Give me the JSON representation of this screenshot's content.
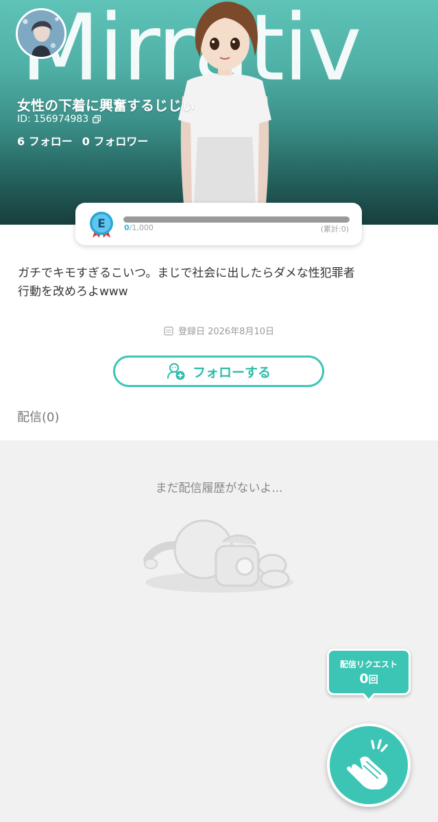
{
  "header": {
    "brand_logo_text": "Mirrativ",
    "profile_name": "女性の下着に興奮するじじぃ",
    "user_id": "ID: 156974983",
    "following": "6 フォロー",
    "followers": "0 フォロワー"
  },
  "level": {
    "badge_letter": "E",
    "current": "0",
    "target": "/1,000",
    "total": "(累計:0)",
    "progress_fraction": 0
  },
  "profile": {
    "bio": "ガチでキモすぎるこいつ。まじで社会に出したらダメな性犯罪者\n行動を改めろよwww",
    "registration": "登録日 2026年8月10日",
    "follow_button": "フォローする",
    "stream_count": "配信(0)"
  },
  "empty_state": {
    "message": "まだ配信履歴がないよ..."
  },
  "request": {
    "label": "配信リクエスト",
    "count": "0",
    "unit": "回"
  },
  "colors": {
    "accent": "#3cc5b4",
    "header_top": "#5fc3b8",
    "header_bottom": "#173f3d"
  },
  "icons": [
    "copy-icon",
    "level-badge-icon",
    "calendar-icon",
    "follow-user-icon",
    "clap-icon"
  ]
}
